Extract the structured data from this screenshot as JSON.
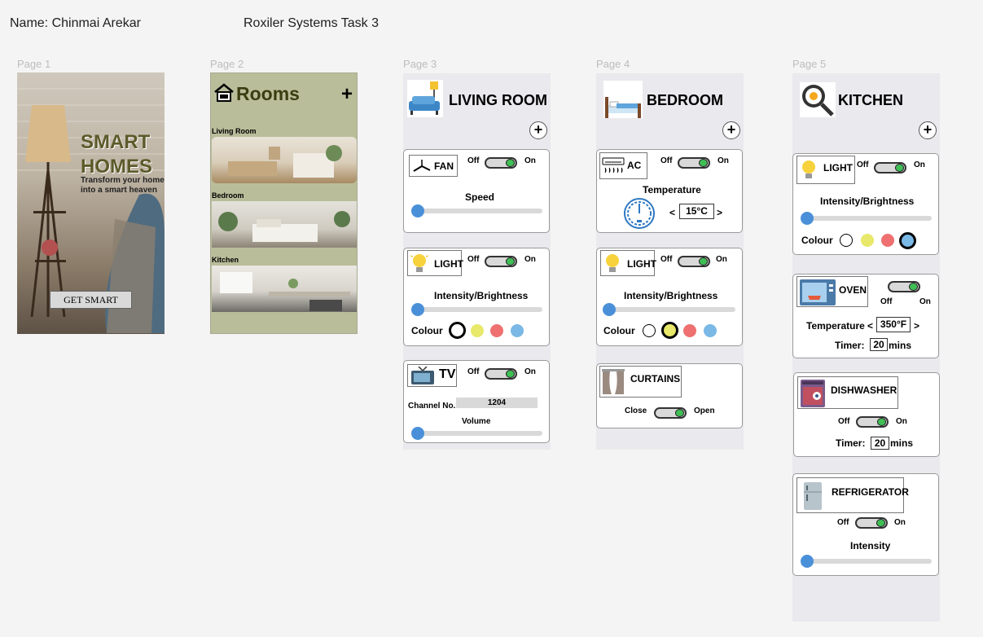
{
  "header": {
    "name": "Name: Chinmai Arekar",
    "task": "Roxiler Systems Task 3"
  },
  "page_labels": [
    "Page 1",
    "Page 2",
    "Page 3",
    "Page 4",
    "Page 5"
  ],
  "page1": {
    "title1": "SMART",
    "title2": "HOMES",
    "tagline1": "Transform your home",
    "tagline2": "into a smart heaven",
    "button": "GET SMART"
  },
  "page2": {
    "title": "Rooms",
    "add": "+",
    "rooms": [
      "Living Room",
      "Bedroom",
      "Kitchen"
    ]
  },
  "page3": {
    "title": "LIVING ROOM",
    "fan": {
      "label": "FAN",
      "off": "Off",
      "on": "On",
      "speed": "Speed"
    },
    "light": {
      "label": "LIGHT",
      "off": "Off",
      "on": "On",
      "intensity": "Intensity/Brightness",
      "colour": "Colour"
    },
    "tv": {
      "label": "TV",
      "off": "Off",
      "on": "On",
      "channel_label": "Channel No.",
      "channel": "1204",
      "volume": "Volume"
    }
  },
  "page4": {
    "title": "BEDROOM",
    "ac": {
      "label": "AC",
      "off": "Off",
      "on": "On",
      "temperature": "Temperature",
      "dec": "<",
      "value": "15°C",
      "inc": ">"
    },
    "light": {
      "label": "LIGHT",
      "off": "Off",
      "on": "On",
      "intensity": "Intensity/Brightness",
      "colour": "Colour"
    },
    "curtains": {
      "label": "CURTAINS",
      "close": "Close",
      "open": "Open"
    }
  },
  "page5": {
    "title": "KITCHEN",
    "light": {
      "label": "LIGHT",
      "off": "Off",
      "on": "On",
      "intensity": "Intensity/Brightness",
      "colour": "Colour"
    },
    "oven": {
      "label": "OVEN",
      "off": "Off",
      "on": "On",
      "temperature": "Temperature",
      "dec": "<",
      "value": "350°F",
      "inc": ">",
      "timer": "Timer:",
      "timer_value": "20",
      "unit": "mins"
    },
    "dishwasher": {
      "label": "DISHWASHER",
      "off": "Off",
      "on": "On",
      "timer": "Timer:",
      "timer_value": "20",
      "unit": "mins"
    },
    "refrigerator": {
      "label": "REFRIGERATOR",
      "off": "Off",
      "on": "On",
      "intensity": "Intensity"
    }
  },
  "colours": {
    "white": "#ffffff",
    "yellow": "#e8e86a",
    "red": "#ee7070",
    "blue": "#7ab8e6",
    "toggle_on": "#3fbf55",
    "slider": "#4a90d9"
  }
}
